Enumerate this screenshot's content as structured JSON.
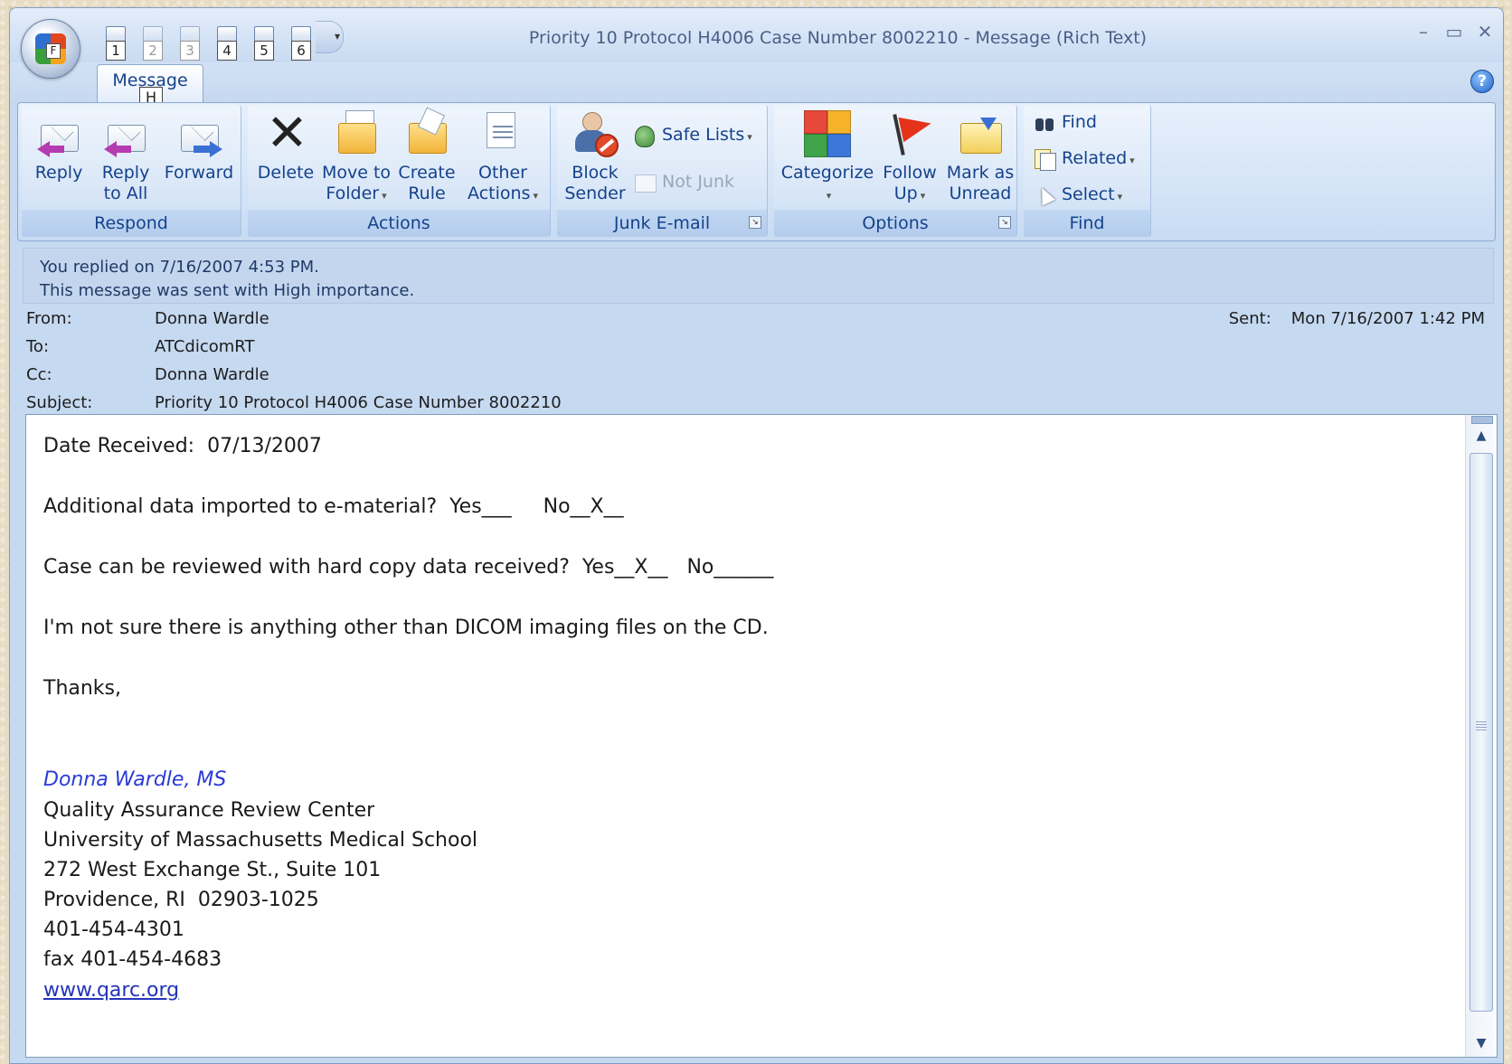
{
  "window": {
    "title": "Priority 10 Protocol  H4006 Case Number 8002210  -  Message (Rich Text)",
    "office_button_key": "F",
    "quick_access": [
      {
        "key": "1",
        "icon": "save-icon",
        "enabled": true
      },
      {
        "key": "2",
        "icon": "undo-icon",
        "enabled": false
      },
      {
        "key": "3",
        "icon": "redo-icon",
        "enabled": false
      },
      {
        "key": "4",
        "icon": "previous-item-icon",
        "enabled": true
      },
      {
        "key": "5",
        "icon": "next-item-icon",
        "enabled": true
      },
      {
        "key": "6",
        "icon": "print-icon",
        "enabled": true
      }
    ],
    "qat_more": "▾",
    "controls": {
      "minimize": "–",
      "maximize": "▭",
      "close": "✕"
    },
    "help": "?"
  },
  "tabs": {
    "message": {
      "label": "Message",
      "key": "H"
    }
  },
  "ribbon": {
    "respond": {
      "label": "Respond",
      "reply": "Reply",
      "reply_all_1": "Reply",
      "reply_all_2": "to All",
      "forward": "Forward"
    },
    "actions": {
      "label": "Actions",
      "delete": "Delete",
      "move_1": "Move to",
      "move_2": "Folder",
      "create_1": "Create",
      "create_2": "Rule",
      "other_1": "Other",
      "other_2": "Actions"
    },
    "junk": {
      "label": "Junk E-mail",
      "block_1": "Block",
      "block_2": "Sender",
      "safe_lists": "Safe Lists",
      "not_junk": "Not Junk"
    },
    "options": {
      "label": "Options",
      "categorize": "Categorize",
      "follow_1": "Follow",
      "follow_2": "Up",
      "mark_1": "Mark as",
      "mark_2": "Unread"
    },
    "find": {
      "label": "Find",
      "find": "Find",
      "related": "Related",
      "select": "Select"
    }
  },
  "infobar": {
    "line1": "You replied on 7/16/2007 4:53 PM.",
    "line2": "This message was sent with High importance."
  },
  "header": {
    "from_label": "From:",
    "from": "Donna Wardle",
    "to_label": "To:",
    "to": "ATCdicomRT",
    "cc_label": "Cc:",
    "cc": "Donna Wardle",
    "subject_label": "Subject:",
    "subject": "Priority 10 Protocol  H4006 Case Number 8002210",
    "sent_label": "Sent:",
    "sent": "Mon 7/16/2007 1:42 PM"
  },
  "body": {
    "line1": "Date Received:  07/13/2007",
    "line2": "Additional data imported to e-material?  Yes___     No__X__",
    "line3": "Case can be reviewed with hard copy data received?  Yes__X__   No______",
    "line4": "I'm not sure there is anything other than DICOM imaging files on the CD.",
    "line5": "Thanks,",
    "sig_name": "Donna Wardle, MS",
    "sig_org": "Quality Assurance Review Center",
    "sig_school": "University of Massachusetts Medical School",
    "sig_addr1": "272 West Exchange St., Suite 101",
    "sig_addr2": "Providence, RI  02903-1025",
    "sig_phone": "401-454-4301",
    "sig_fax": "fax 401-454-4683",
    "sig_web": "www.qarc.org"
  }
}
